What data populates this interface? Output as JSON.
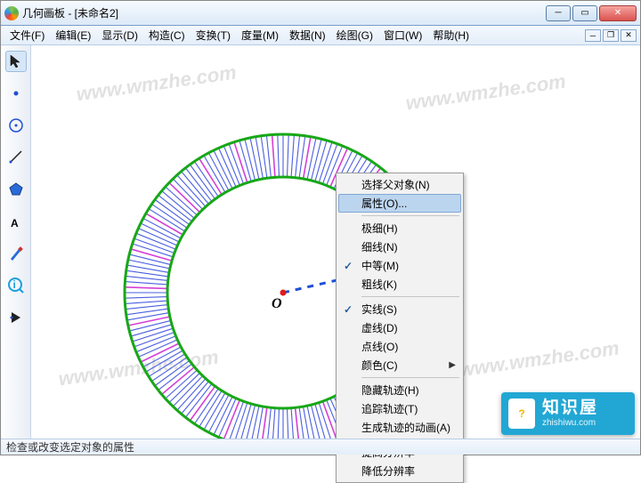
{
  "window": {
    "title": "几何画板 - [未命名2]"
  },
  "menu": {
    "items": [
      "文件(F)",
      "编辑(E)",
      "显示(D)",
      "构造(C)",
      "变换(T)",
      "度量(M)",
      "数据(N)",
      "绘图(G)",
      "窗口(W)",
      "帮助(H)"
    ]
  },
  "tools": [
    {
      "name": "pointer-tool",
      "selected": true
    },
    {
      "name": "point-tool"
    },
    {
      "name": "circle-tool"
    },
    {
      "name": "line-tool"
    },
    {
      "name": "polygon-tool"
    },
    {
      "name": "text-tool"
    },
    {
      "name": "pen-tool"
    },
    {
      "name": "info-tool"
    },
    {
      "name": "custom-tool"
    }
  ],
  "context_menu": {
    "sections": [
      [
        {
          "label": "选择父对象(N)"
        },
        {
          "label": "属性(O)...",
          "highlighted": true
        }
      ],
      [
        {
          "label": "极细(H)"
        },
        {
          "label": "细线(N)"
        },
        {
          "label": "中等(M)",
          "checked": true
        },
        {
          "label": "粗线(K)"
        }
      ],
      [
        {
          "label": "实线(S)",
          "checked": true
        },
        {
          "label": "虚线(D)"
        },
        {
          "label": "点线(O)"
        },
        {
          "label": "颜色(C)",
          "submenu": true
        }
      ],
      [
        {
          "label": "隐藏轨迹(H)"
        },
        {
          "label": "追踪轨迹(T)"
        },
        {
          "label": "生成轨迹的动画(A)"
        }
      ],
      [
        {
          "label": "提高分辨率"
        },
        {
          "label": "降低分辨率"
        }
      ]
    ]
  },
  "canvas": {
    "center_label": "O",
    "watermarks": [
      "www.wmzhe.com",
      "www.wmzhe.com",
      "www.wmzhe.com",
      "www.wmzhe.com"
    ]
  },
  "status": {
    "text": "检查或改变选定对象的属性"
  },
  "brand": {
    "name": "知识屋",
    "domain": "zhishiwu.com",
    "mark": "?"
  },
  "chart_data": {
    "type": "other",
    "description": "Annulus (ring) locus drawn in Geometer's Sketchpad",
    "center": "O",
    "outer_radius_approx_px": 178,
    "inner_radius_approx_px": 130,
    "stroke_color_outer": "#17a817",
    "fill_pattern": "radial blue/magenta strokes",
    "dashed_radius_line": true
  }
}
